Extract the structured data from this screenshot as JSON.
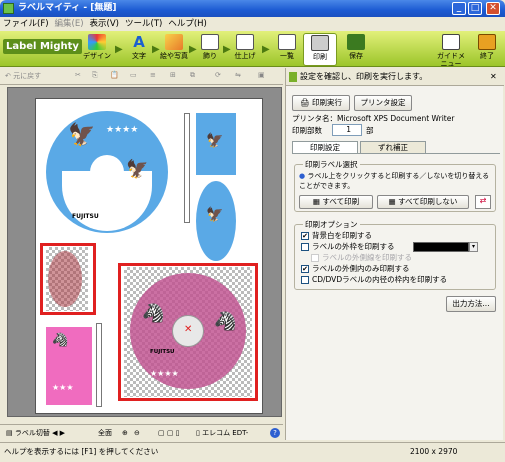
{
  "window": {
    "title": "ラベルマイティ - [無題]",
    "min": "_",
    "max": "□",
    "close": "✕"
  },
  "menu": [
    "ファイル(F)",
    "編集(E)",
    "表示(V)",
    "ツール(T)",
    "ヘルプ(H)"
  ],
  "ribbon": {
    "logo": "Label Mighty",
    "items": [
      "デザイン",
      "文字",
      "絵や写真",
      "飾り",
      "仕上げ",
      "一覧",
      "印刷",
      "保存"
    ],
    "right": [
      "ガイドメニュー",
      "終了"
    ]
  },
  "toolbar": {
    "undo": "元に戻す"
  },
  "paper": {
    "brand": "FUJITSU",
    "brand2": "FUJITSU"
  },
  "bottom": {
    "label_switch": "ラベル切替",
    "full": "全面",
    "editor": "エレコム EDT-"
  },
  "status": {
    "help": "ヘルプを表示するには [F1] を押してください",
    "size": "2100 x 2970"
  },
  "panel": {
    "header": "設定を確認し、印刷を実行します。",
    "print_btn": "印刷実行",
    "printer_btn": "プリンタ設定",
    "printer_name": "プリンタ名：Microsoft XPS Document Writer",
    "copies_label": "印刷部数",
    "copies": "1",
    "copies_unit": "部",
    "tabs": [
      "印刷設定",
      "ずれ補正"
    ],
    "select_group": "印刷ラベル選択",
    "select_note": "ラベル上をクリックすると印刷する／しないを切り替えることができます。",
    "all_print": "すべて印刷",
    "none_print": "すべて印刷しない",
    "options_group": "印刷オプション",
    "options": [
      {
        "label": "背景白を印刷する",
        "checked": true,
        "disabled": false
      },
      {
        "label": "ラベルの外枠を印刷する",
        "checked": false,
        "disabled": false
      },
      {
        "label": "ラベルの外側線を印刷する",
        "checked": false,
        "disabled": true
      },
      {
        "label": "ラベルの外側内のみ印刷する",
        "checked": true,
        "disabled": false
      },
      {
        "label": "CD/DVDラベルの内径の枠内を印刷する",
        "checked": false,
        "disabled": false
      }
    ],
    "output_btn": "出力方法..."
  },
  "colors": {
    "blue": "#5aa9e6",
    "pink": "#f06cbf",
    "magenta": "#c0508f",
    "red": "#e02020",
    "green": "#8dbb26"
  }
}
